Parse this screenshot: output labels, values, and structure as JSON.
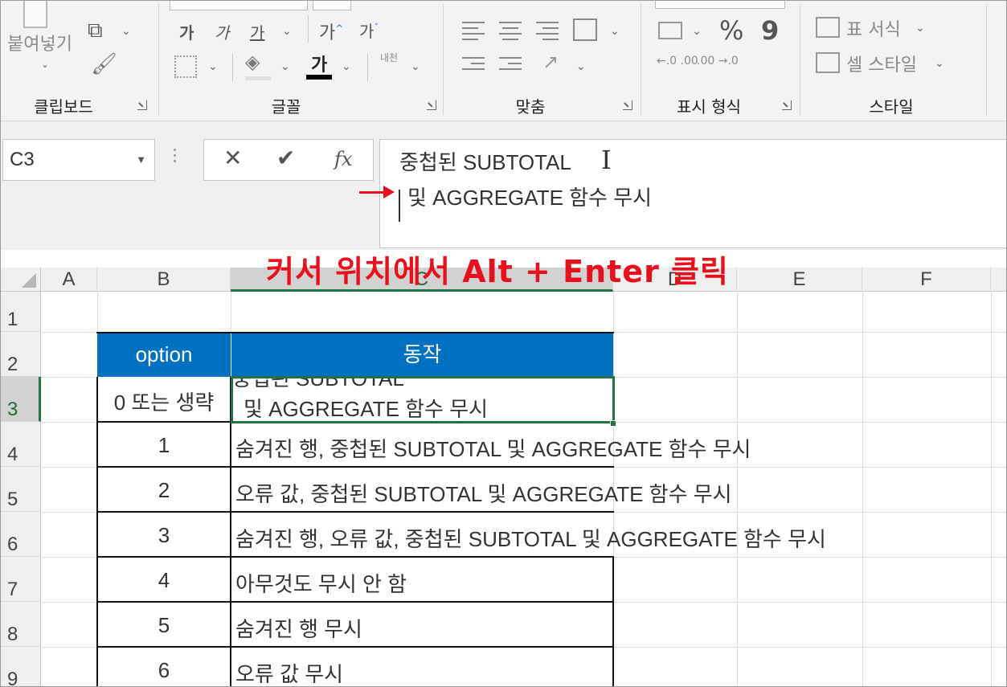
{
  "ribbon": {
    "clipboard": {
      "paste_label": "붙여넣기",
      "group_label": "클립보드"
    },
    "font": {
      "row1": [
        "가",
        "가",
        "가"
      ],
      "grow_label": "가",
      "shrink_label": "가",
      "font_color_label": "가",
      "phonetic_label": "내천",
      "group_label": "글꼴"
    },
    "alignment": {
      "group_label": "맞춤"
    },
    "number": {
      "percent_label": "%",
      "comma_label": "9",
      "dec_inc": "←.0 .00",
      "dec_dec": ".00 →.0",
      "group_label": "표시 형식"
    },
    "styles": {
      "format_table_label": "표 서식",
      "cell_styles_label": "셀 스타일",
      "group_label": "스타일"
    }
  },
  "formula_bar": {
    "name_box": "C3",
    "cancel_icon": "✕",
    "enter_icon": "✔",
    "fx_label": "fx",
    "line1": "중첩된 SUBTOTAL",
    "line2": "및 AGGREGATE 함수 무시"
  },
  "annotation": {
    "text": "커서 위치에서 Alt + Enter 클릭",
    "arrow_color": "#e8101c"
  },
  "sheet": {
    "columns": [
      "A",
      "B",
      "C",
      "D",
      "E",
      "F"
    ],
    "selected_column": "C",
    "rows": [
      "1",
      "2",
      "3",
      "4",
      "5",
      "6",
      "7",
      "8",
      "9"
    ],
    "selected_row": "3",
    "header": {
      "option": "option",
      "action": "동작"
    },
    "header_fill": "#0070c0",
    "c3_top_partial": "중첩된 SUBTOTAL",
    "table": [
      {
        "option": "0 또는 생략",
        "action": "및 AGGREGATE 함수 무시"
      },
      {
        "option": "1",
        "action": "숨겨진 행, 중첩된 SUBTOTAL 및 AGGREGATE 함수 무시"
      },
      {
        "option": "2",
        "action": "오류 값, 중첩된 SUBTOTAL 및 AGGREGATE 함수 무시"
      },
      {
        "option": "3",
        "action": "숨겨진 행, 오류 값, 중첩된 SUBTOTAL 및 AGGREGATE 함수 무시"
      },
      {
        "option": "4",
        "action": "아무것도 무시 안 함"
      },
      {
        "option": "5",
        "action": "숨겨진 행 무시"
      },
      {
        "option": "6",
        "action": "오류 값 무시"
      }
    ],
    "active_cell_color": "#217346"
  }
}
